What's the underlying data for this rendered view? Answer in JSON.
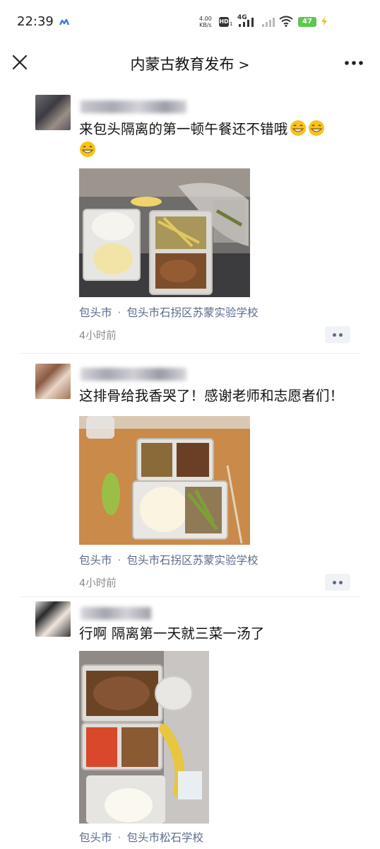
{
  "status_bar": {
    "time": "22:39",
    "net_speed_value": "4.00",
    "net_speed_unit": "KB/s",
    "hd": "HD",
    "sim1": "1",
    "network": "4G",
    "battery": "47"
  },
  "nav": {
    "title": "内蒙古教育发布",
    "chevron": ">"
  },
  "posts": [
    {
      "text": "来包头隔离的第一顿午餐还不错哦",
      "emoji": [
        "grinning-face",
        "grinning-face",
        "grinning-face"
      ],
      "location_city": "包头市",
      "location_separator": "·",
      "location_place": "包头市石拐区苏蒙实验学校",
      "time_ago": "4小时前"
    },
    {
      "text": "这排骨给我香哭了！感谢老师和志愿者们！",
      "location_city": "包头市",
      "location_separator": "·",
      "location_place": "包头市石拐区苏蒙实验学校",
      "time_ago": "4小时前"
    },
    {
      "text": "行啊  隔离第一天就三菜一汤了",
      "location_city": "包头市",
      "location_separator": "·",
      "location_place": "包头市松石学校"
    }
  ],
  "colors": {
    "link": "#5b6b8c",
    "battery": "#5ac84a",
    "more_button_bg": "#f1f2f5"
  }
}
